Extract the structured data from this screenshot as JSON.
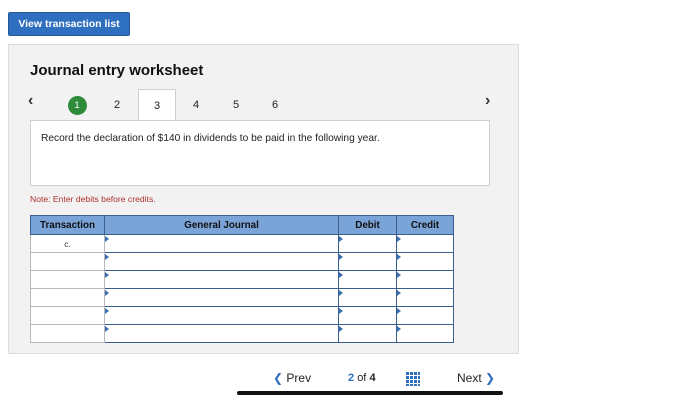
{
  "toolbar": {
    "view_list_label": "View transaction list"
  },
  "worksheet": {
    "title": "Journal entry worksheet",
    "steps": [
      {
        "label": "1",
        "state": "done"
      },
      {
        "label": "2",
        "state": "pending"
      },
      {
        "label": "3",
        "state": "active"
      },
      {
        "label": "4",
        "state": "pending"
      },
      {
        "label": "5",
        "state": "pending"
      },
      {
        "label": "6",
        "state": "pending"
      }
    ],
    "prev_icon": "chevron-left-icon",
    "next_icon": "chevron-right-icon",
    "prompt": "Record the declaration of $140 in dividends to be paid in the following year.",
    "note": "Note: Enter debits before credits."
  },
  "journal": {
    "headers": [
      "Transaction",
      "General Journal",
      "Debit",
      "Credit"
    ],
    "rows": [
      {
        "transaction": "c.",
        "account": "",
        "debit": "",
        "credit": ""
      },
      {
        "transaction": "",
        "account": "",
        "debit": "",
        "credit": ""
      },
      {
        "transaction": "",
        "account": "",
        "debit": "",
        "credit": ""
      },
      {
        "transaction": "",
        "account": "",
        "debit": "",
        "credit": ""
      },
      {
        "transaction": "",
        "account": "",
        "debit": "",
        "credit": ""
      },
      {
        "transaction": "",
        "account": "",
        "debit": "",
        "credit": ""
      }
    ]
  },
  "footer": {
    "prev_label": "Prev",
    "page_current": "2",
    "page_of": "of",
    "page_total": "4",
    "next_label": "Next",
    "grid_icon": "grid-icon"
  },
  "colors": {
    "primary": "#2f6fbf",
    "header_blue": "#7aa3d8",
    "done_green": "#2e8b3a",
    "note_red": "#b03030"
  }
}
